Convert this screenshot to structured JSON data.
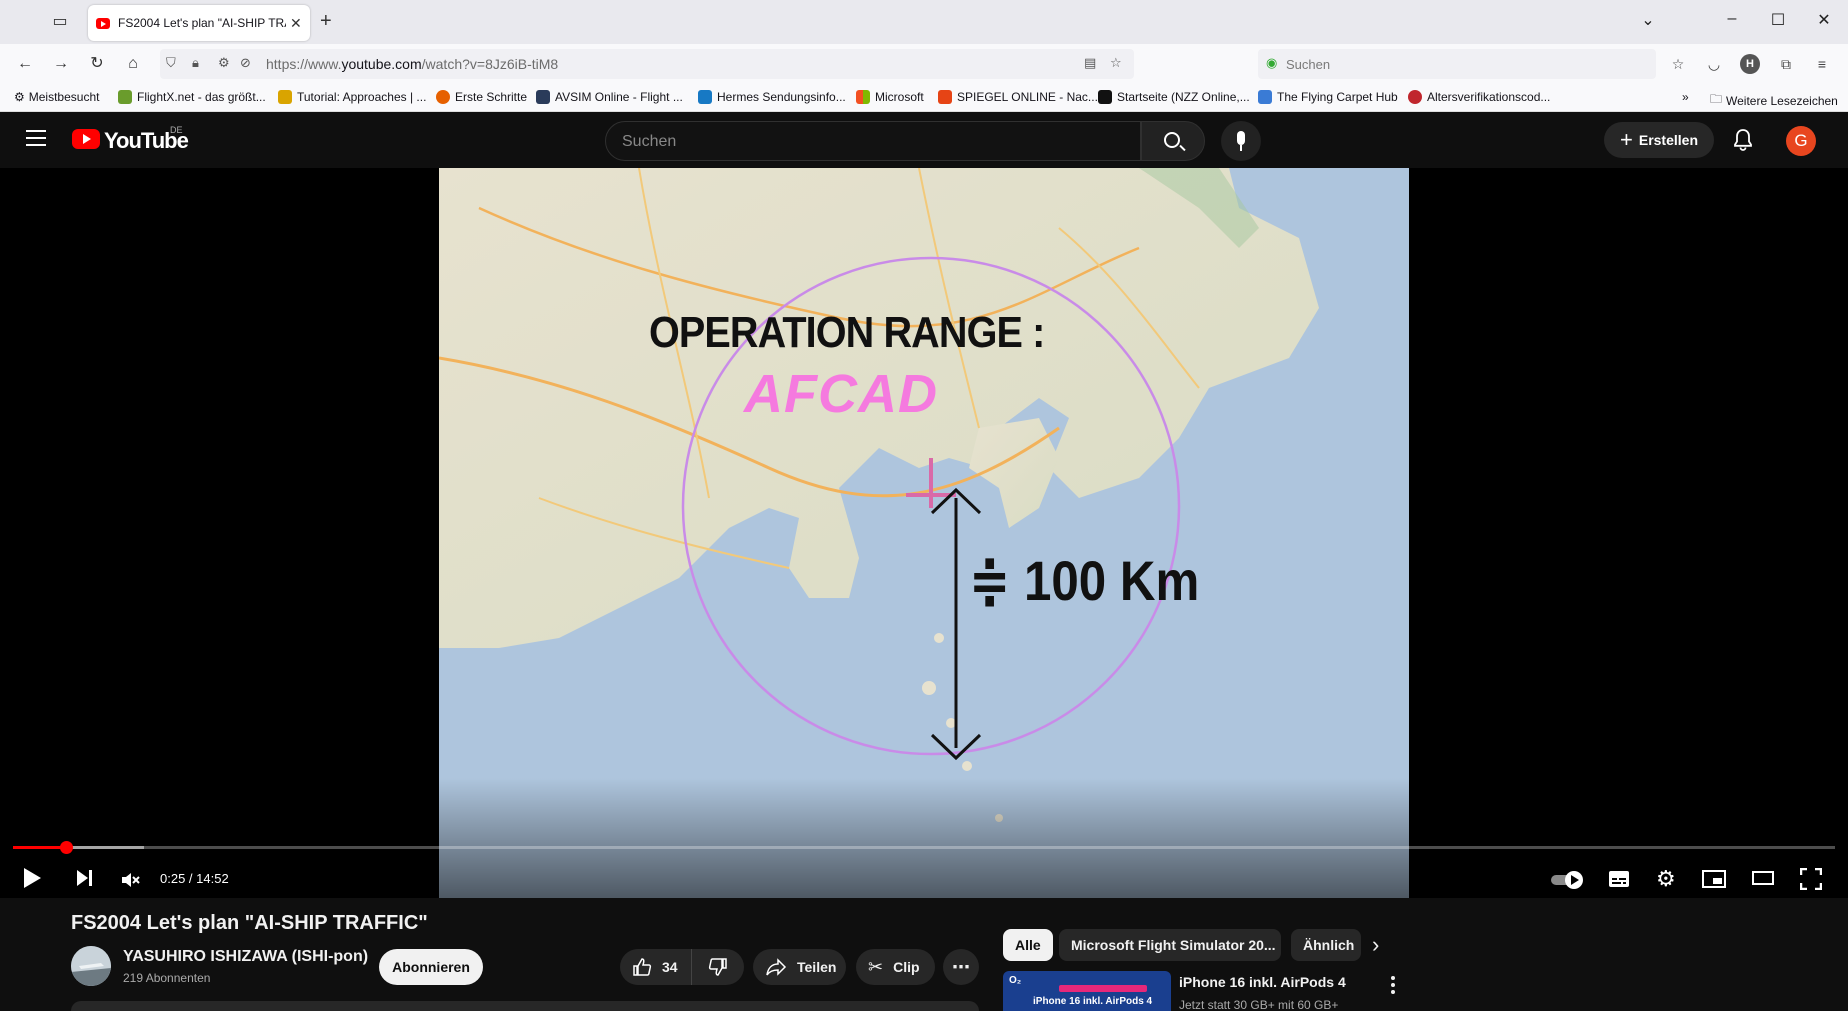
{
  "browser": {
    "tab_title": "FS2004 Let's plan \"AI-SHIP TRAFFIC\"",
    "url_prefix": "https://www.",
    "url_domain": "youtube.com",
    "url_path": "/watch?v=8Jz6iB-tiM8",
    "search_placeholder": "Suchen",
    "profile_letter": "H",
    "bookmarks": [
      "Meistbesucht",
      "FlightX.net - das größt...",
      "Tutorial: Approaches | ...",
      "Erste Schritte",
      "AVSIM Online - Flight ...",
      "Hermes Sendungsinfo...",
      "Microsoft",
      "SPIEGEL ONLINE - Nac...",
      "Startseite (NZZ Online,...",
      "The Flying Carpet Hub",
      "Altersverifikationscod..."
    ],
    "other_bookmarks": "Weitere Lesezeichen"
  },
  "youtube": {
    "wordmark": "YouTube",
    "region": "DE",
    "search_placeholder": "Suchen",
    "create_label": "Erstellen",
    "avatar_letter": "G"
  },
  "video_overlay": {
    "heading": "OPERATION RANGE :",
    "tool": "AFCAD",
    "distance": "≑ 100 Km"
  },
  "player": {
    "current_time": "0:25",
    "duration": "14:52",
    "time_display": "0:25 / 14:52",
    "played_fraction": 0.029,
    "buffered_fraction": 0.072
  },
  "video": {
    "title": "FS2004 Let's plan \"AI-SHIP TRAFFIC\"",
    "channel_name": "YASUHIRO ISHIZAWA (ISHI-pon)",
    "subscribers": "219 Abonnenten",
    "subscribe_label": "Abonnieren",
    "likes": "34",
    "share_label": "Teilen",
    "clip_label": "Clip"
  },
  "sidebar": {
    "chips": [
      "Alle",
      "Microsoft Flight Simulator 20...",
      "Ähnlich"
    ],
    "recommendation": {
      "title": "iPhone 16 inkl. AirPods 4",
      "subtitle": "Jetzt statt 30 GB+ mit 60 GB+",
      "thumb_text": "iPhone 16 inkl. AirPods 4"
    }
  },
  "colors": {
    "youtube_red": "#ff0000",
    "dark_bg": "#0f0f0f",
    "afcad_pink": "#f57adf",
    "avatar_orange": "#e8461f"
  }
}
